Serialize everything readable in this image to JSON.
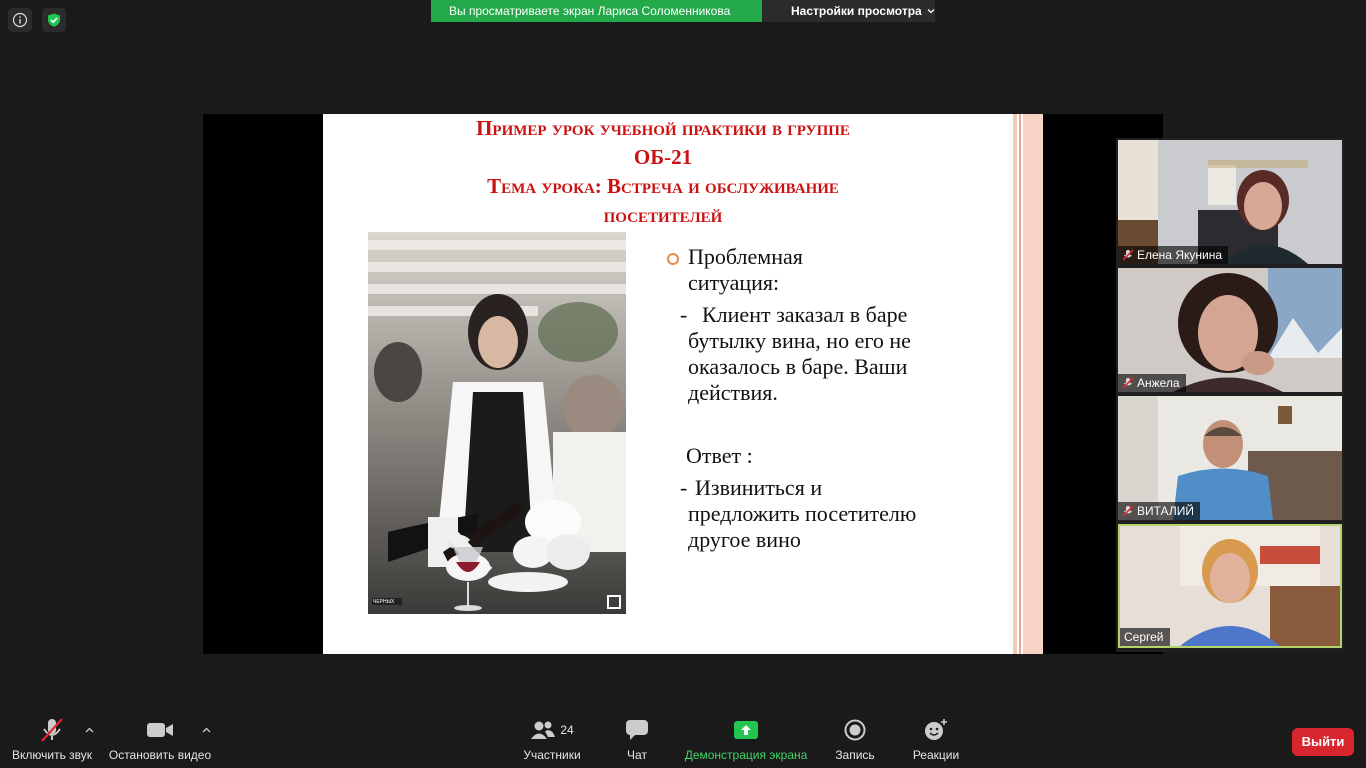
{
  "banner": {
    "viewing_text": "Вы просматриваете экран Лариса Соломенникова",
    "settings_label": "Настройки просмотра"
  },
  "slide": {
    "title_line1": "Пример  урок учебной практики в группе",
    "title_line2": "ОБ-21",
    "title_line3": "Тема урока: Встреча и обслуживание",
    "title_line4": "посетителей",
    "problem_heading": "Проблемная ситуация:",
    "problem_dash": "-",
    "problem_text": "Клиент заказал в баре бутылку вина, но его не оказалось в баре. Ваши действия.",
    "answer_heading": "Ответ :",
    "answer_dash": "-",
    "answer_text": "Извиниться и предложить посетителю другое вино",
    "photo_logo": "ЧЕРНЫХ"
  },
  "participants": [
    {
      "name": "Елена Якунина",
      "muted": true
    },
    {
      "name": "Анжела",
      "muted": true
    },
    {
      "name": "ВИТАЛИЙ",
      "muted": true
    },
    {
      "name": "Сергей",
      "muted": false,
      "active": true
    }
  ],
  "toolbar": {
    "unmute_label": "Включить звук",
    "stop_video_label": "Остановить видео",
    "participants_label": "Участники",
    "participants_count": "24",
    "chat_label": "Чат",
    "share_label": "Демонстрация экрана",
    "record_label": "Запись",
    "reactions_label": "Реакции",
    "leave_label": "Выйти"
  },
  "colors": {
    "share_green": "#23a94a",
    "slide_title_red": "#cc1111",
    "leave_red": "#d8262f",
    "active_speaker": "#b5d36b",
    "accent_orange": "#f5883f"
  }
}
